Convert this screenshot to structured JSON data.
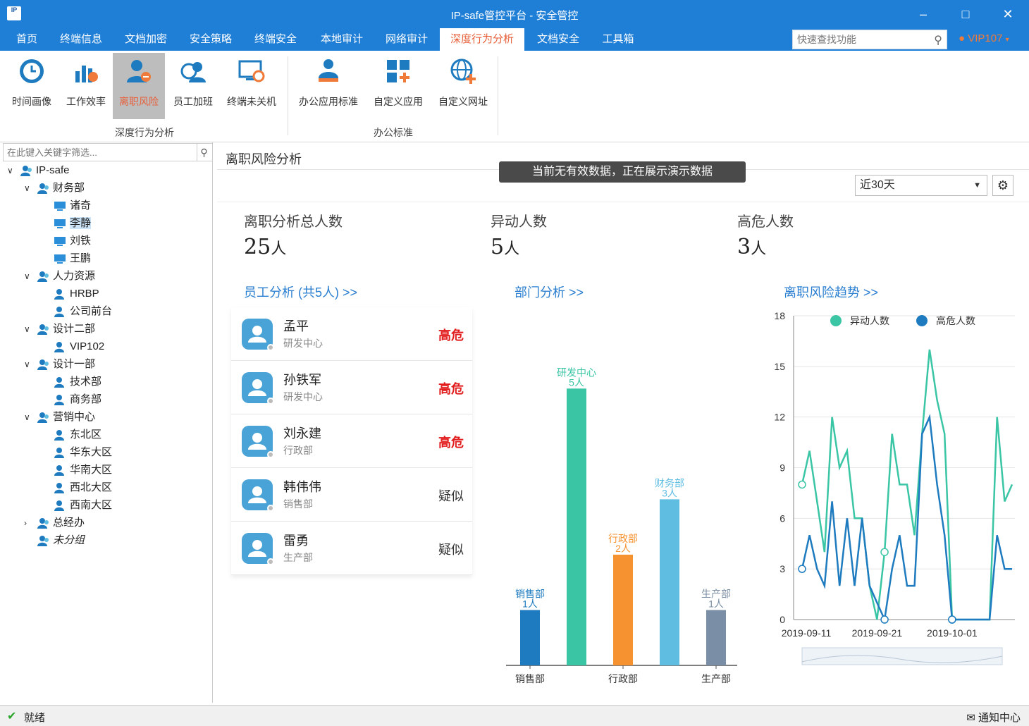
{
  "window": {
    "title": "IP-safe管控平台 - 安全管控",
    "logo_text": "IP"
  },
  "menu": {
    "tabs": [
      "首页",
      "终端信息",
      "文档加密",
      "安全策略",
      "终端安全",
      "本地审计",
      "网络审计",
      "深度行为分析",
      "文档安全",
      "工具箱"
    ],
    "active": "深度行为分析",
    "search_placeholder": "快速查找功能",
    "user": "VIP107"
  },
  "ribbon": {
    "buttons": [
      "时间画像",
      "工作效率",
      "离职风险",
      "员工加班",
      "终端未关机",
      "办公应用标准",
      "自定义应用",
      "自定义网址"
    ],
    "active": "离职风险",
    "groups": [
      "深度行为分析",
      "办公标准"
    ]
  },
  "tree": {
    "filter_placeholder": "在此键入关键字筛选...",
    "nodes": [
      {
        "label": "IP-safe"
      },
      {
        "label": "财务部"
      },
      {
        "label": "诸奇"
      },
      {
        "label": "李静"
      },
      {
        "label": "刘铁"
      },
      {
        "label": "王鹏"
      },
      {
        "label": "人力资源"
      },
      {
        "label": "HRBP"
      },
      {
        "label": "公司前台"
      },
      {
        "label": "设计二部"
      },
      {
        "label": "VIP102"
      },
      {
        "label": "设计一部"
      },
      {
        "label": "技术部"
      },
      {
        "label": "商务部"
      },
      {
        "label": "营销中心"
      },
      {
        "label": "东北区"
      },
      {
        "label": "华东大区"
      },
      {
        "label": "华南大区"
      },
      {
        "label": "西北大区"
      },
      {
        "label": "西南大区"
      },
      {
        "label": "总经办"
      },
      {
        "label": "未分组"
      }
    ]
  },
  "page": {
    "title": "离职风险分析",
    "notice": "当前无有效数据，正在展示演示数据",
    "range": "近30天",
    "stats": [
      {
        "label": "离职分析总人数",
        "value": "25",
        "unit": "人"
      },
      {
        "label": "异动人数",
        "value": "5",
        "unit": "人"
      },
      {
        "label": "高危人数",
        "value": "3",
        "unit": "人"
      }
    ],
    "sections": {
      "employee": "员工分析 (共5人) >>",
      "dept": "部门分析 >>",
      "trend": "离职风险趋势 >>"
    }
  },
  "employees": [
    {
      "name": "孟平",
      "dept": "研发中心",
      "risk": "高危",
      "level": "high"
    },
    {
      "name": "孙铁军",
      "dept": "研发中心",
      "risk": "高危",
      "level": "high"
    },
    {
      "name": "刘永建",
      "dept": "行政部",
      "risk": "高危",
      "level": "high"
    },
    {
      "name": "韩伟伟",
      "dept": "销售部",
      "risk": "疑似",
      "level": "sus"
    },
    {
      "name": "雷勇",
      "dept": "生产部",
      "risk": "疑似",
      "level": "sus"
    }
  ],
  "chart_data": [
    {
      "type": "bar",
      "categories": [
        "销售部",
        "研发中心",
        "行政部",
        "财务部",
        "生产部"
      ],
      "values": [
        1,
        5,
        2,
        3,
        1
      ],
      "value_suffix": "人",
      "xticks": [
        "销售部",
        "行政部",
        "生产部"
      ],
      "colors": [
        "#1e7bbf",
        "#3ac5a5",
        "#f6922f",
        "#5fbde2",
        "#7a8fa6"
      ]
    },
    {
      "type": "line",
      "ylim": [
        0,
        18
      ],
      "yticks": [
        0,
        3,
        6,
        9,
        12,
        15,
        18
      ],
      "xticks": [
        "2019-09-11",
        "2019-09-21",
        "2019-10-01"
      ],
      "legend_position": "top",
      "series": [
        {
          "name": "异动人数",
          "color": "#3ac5a5",
          "values": [
            8,
            10,
            7,
            4,
            12,
            9,
            10,
            6,
            6,
            2,
            0,
            4,
            11,
            8,
            8,
            5,
            11,
            16,
            13,
            11,
            0,
            0,
            0,
            0,
            0,
            0,
            12,
            7,
            8
          ]
        },
        {
          "name": "高危人数",
          "color": "#1e7bbf",
          "values": [
            3,
            5,
            3,
            2,
            7,
            2,
            6,
            2,
            6,
            2,
            1,
            0,
            3,
            5,
            2,
            2,
            11,
            12,
            8,
            5,
            0,
            0,
            0,
            0,
            0,
            0,
            5,
            3,
            3
          ]
        }
      ]
    }
  ],
  "status": {
    "ready": "就绪",
    "notify": "通知中心"
  }
}
